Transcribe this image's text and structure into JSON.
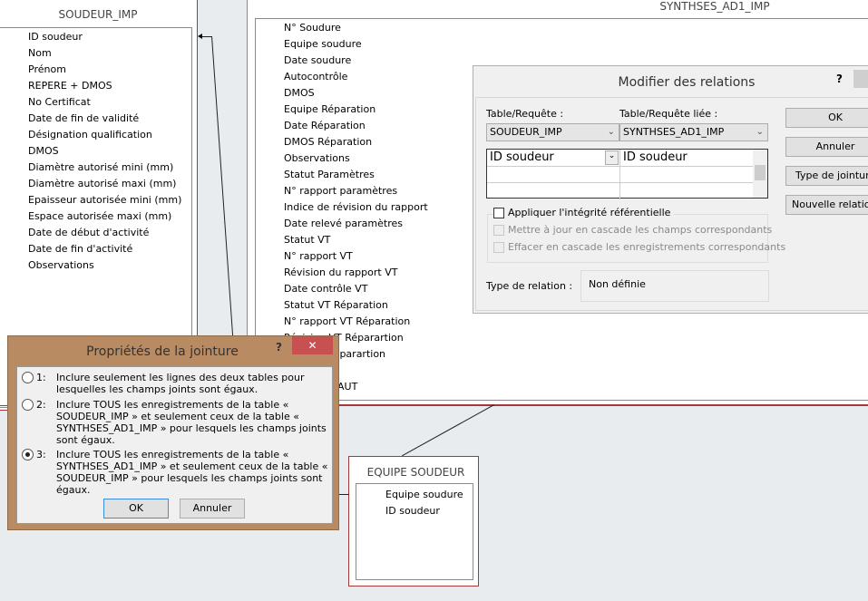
{
  "tables": {
    "soudeur_imp": {
      "title": "SOUDEUR_IMP",
      "fields": [
        "ID soudeur",
        "Nom",
        "Prénom",
        "REPERE + DMOS",
        "No Certificat",
        "Date de fin de validité",
        "Désignation qualification",
        "DMOS",
        "Diamètre autorisé mini (mm)",
        "Diamètre autorisé maxi (mm)",
        "Epaisseur autorisée mini (mm)",
        "Espace autorisée maxi (mm)",
        "Date de début d'activité",
        "Date de fin d'activité",
        "Observations"
      ]
    },
    "synthses": {
      "title": "SYNTHSES_AD1_IMP",
      "fields": [
        "N° Soudure",
        "Equipe soudure",
        "Date soudure",
        "Autocontrôle",
        "DMOS",
        "Equipe Réparation",
        "Date Réparation",
        "DMOS Réparation",
        "Observations",
        "Statut Paramètres",
        "N° rapport paramètres",
        "Indice de révision du rapport",
        "Date relevé paramètres",
        "Statut VT",
        "N° rapport VT",
        "Révision du rapport VT",
        "Date contrôle VT",
        "Statut VT Réparation",
        "N° rapport VT Réparation",
        "Révision VT Réparartion",
        "Date VT Réparartion"
      ],
      "partial_field": "AUT"
    },
    "equipe": {
      "title": "EQUIPE SOUDEUR",
      "fields": [
        "Equipe soudure",
        "ID soudeur"
      ]
    }
  },
  "relations_dialog": {
    "title": "Modifier des relations",
    "help": "?",
    "table_label": "Table/Requête :",
    "linked_label": "Table/Requête liée :",
    "table_value": "SOUDEUR_IMP",
    "linked_value": "SYNTHSES_AD1_IMP",
    "field_left": "ID soudeur",
    "field_right": "ID soudeur",
    "integrity": "Appliquer l'intégrité référentielle",
    "cascade_update": "Mettre à jour en cascade les champs correspondants",
    "cascade_delete": "Effacer en cascade les enregistrements correspondants",
    "relation_type_label": "Type de relation :",
    "relation_type_value": "Non définie",
    "ok": "OK",
    "cancel": "Annuler",
    "join_type": "Type de jointure...",
    "new_relation": "Nouvelle relation..."
  },
  "join_dialog": {
    "title": "Propriétés de la jointure",
    "help": "?",
    "close": "✕",
    "selected": 3,
    "options": [
      {
        "num": "1:",
        "text": "Inclure seulement les lignes des deux tables pour lesquelles les champs joints sont égaux."
      },
      {
        "num": "2:",
        "text": "Inclure TOUS les enregistrements de la table « SOUDEUR_IMP » et seulement ceux de la table « SYNTHSES_AD1_IMP » pour lesquels les champs joints sont égaux."
      },
      {
        "num": "3:",
        "text": "Inclure TOUS les enregistrements de la table « SYNTHSES_AD1_IMP » et seulement ceux de la table « SOUDEUR_IMP » pour lesquels les champs joints sont égaux."
      }
    ],
    "ok": "OK",
    "cancel": "Annuler"
  },
  "colors": {
    "table_border": "#a4373a",
    "dialog_frame": "#b98b62",
    "close_button": "#c75050",
    "background": "#e9ecef"
  }
}
